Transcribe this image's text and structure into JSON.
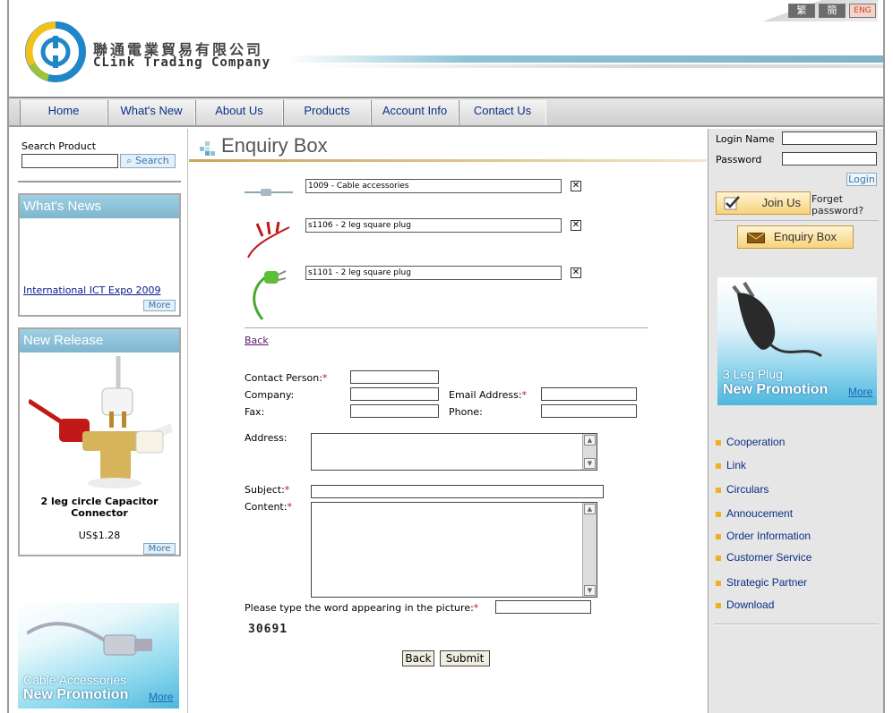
{
  "lang": {
    "traditional": "繁",
    "simplified": "簡",
    "english": "ENG"
  },
  "header": {
    "company_zh": "聯通電業貿易有限公司",
    "company_en": "CLink Trading Company"
  },
  "nav": {
    "items": [
      "Home",
      "What's New",
      "About Us",
      "Products",
      "Account Info",
      "Contact Us"
    ]
  },
  "left": {
    "search_label": "Search Product",
    "search_button": "Search",
    "news_title": "What's News",
    "news_link": "International ICT Expo 2009",
    "more": "More",
    "release_title": "New Release",
    "release_name": "2 leg circle Capacitor Connector",
    "release_price": "US$1.28",
    "cable_promo_line1": "Cable Accessories",
    "cable_promo_line2": "New Promotion",
    "cable_promo_more": "More"
  },
  "main": {
    "title": "Enquiry Box",
    "items": [
      {
        "value": "1009 - Cable accessories"
      },
      {
        "value": "s1106 - 2 leg square plug"
      },
      {
        "value": "s1101 - 2 leg square plug"
      }
    ],
    "remove_glyph": "✕",
    "back_link": "Back",
    "form": {
      "contact_person": "Contact Person:",
      "company": "Company:",
      "email": "Email Address:",
      "fax": "Fax:",
      "phone": "Phone:",
      "address": "Address:",
      "subject": "Subject:",
      "content": "Content:",
      "captcha_prompt": "Please type the word appearing in the picture:",
      "captcha_code": "30691",
      "required_mark": "*"
    },
    "back_button": "Back",
    "submit_button": "Submit"
  },
  "right": {
    "login_name": "Login Name",
    "password": "Password",
    "login_button": "Login",
    "join_button": "Join Us",
    "forgot": "Forget password?",
    "enquiry_button": "Enquiry Box",
    "plug_promo_line1": "3 Leg Plug",
    "plug_promo_line2": "New Promotion",
    "plug_promo_more": "More",
    "links": [
      "Cooperation",
      "Link",
      "Circulars",
      "Annoucement",
      "Order Information",
      "Customer Service",
      "Strategic Partner",
      "Download"
    ]
  },
  "colors": {
    "nav_text": "#0b2f86",
    "box_title": "#8cc4d8",
    "required": "#d01010",
    "promo_blue": "#4fb7dc"
  }
}
